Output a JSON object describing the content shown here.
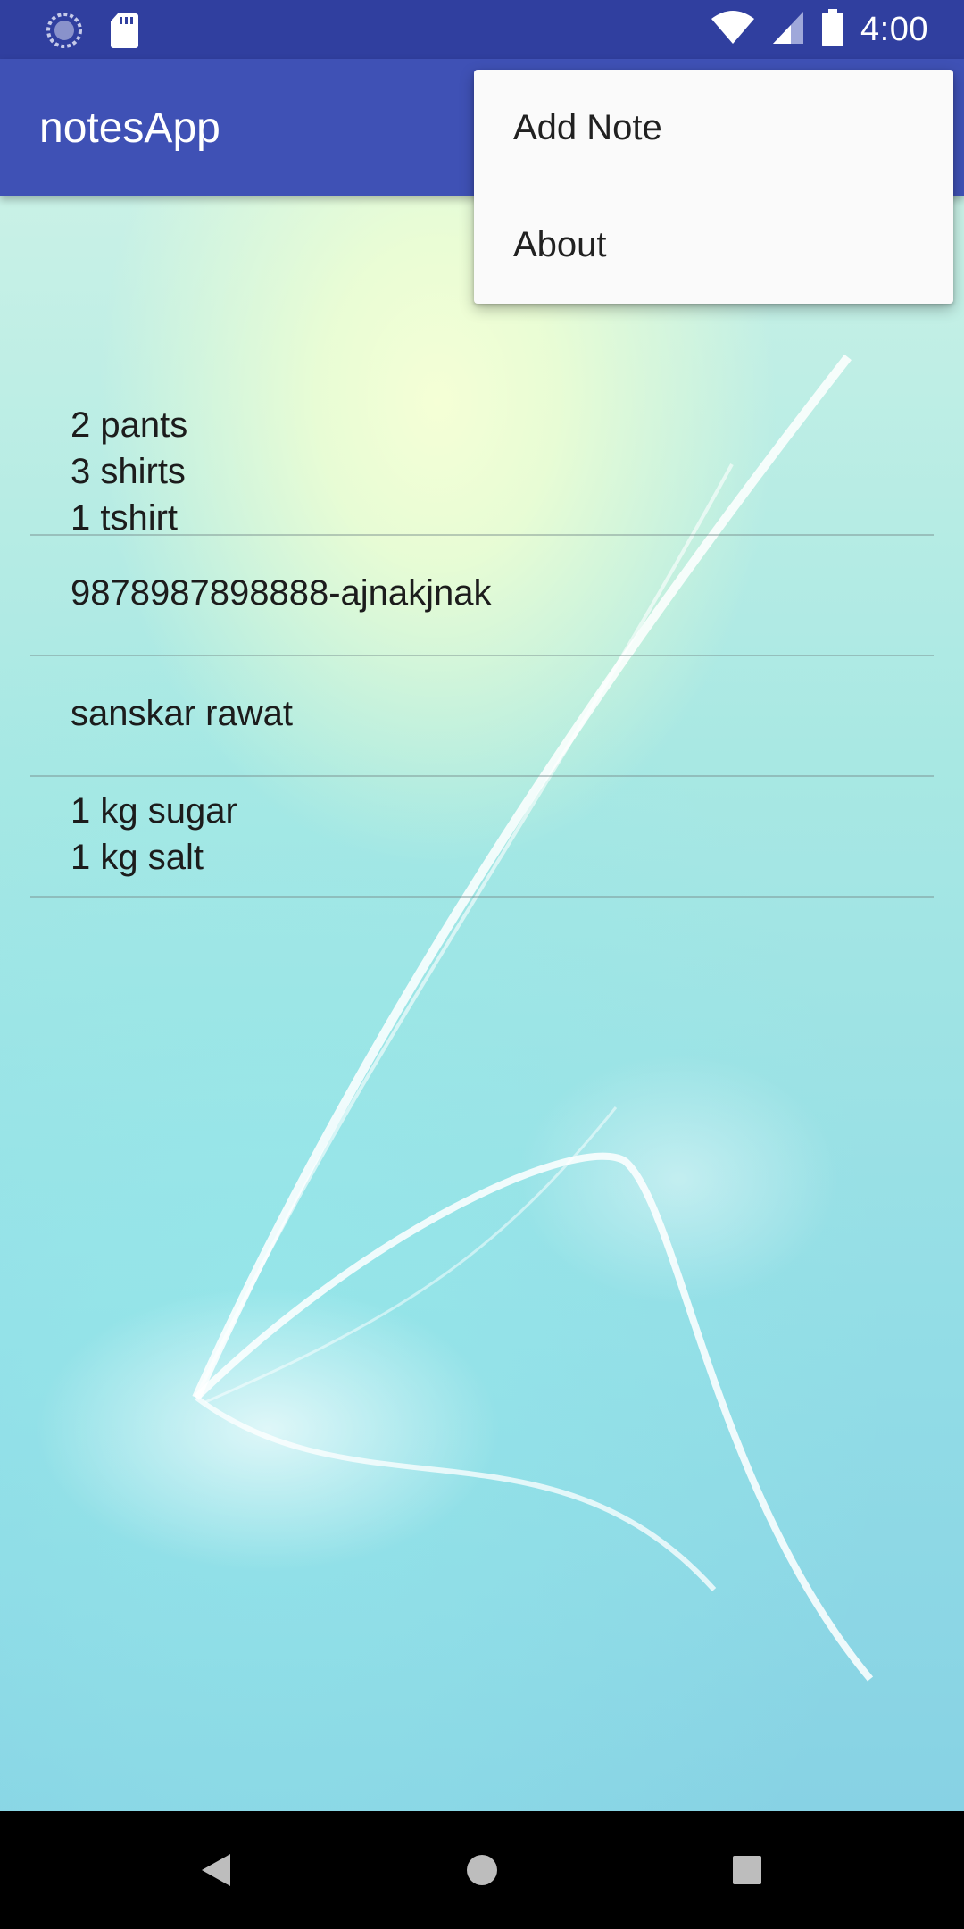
{
  "status_bar": {
    "time": "4:00",
    "left_icons": [
      "sync-icon",
      "sd-card-icon"
    ],
    "right_icons": [
      "wifi-icon",
      "cell-signal-icon",
      "battery-icon"
    ]
  },
  "app_bar": {
    "title": "notesApp",
    "color": "#3f51b5",
    "status_color": "#303f9f"
  },
  "overflow_menu": {
    "items": [
      {
        "label": "Add Note"
      },
      {
        "label": "About"
      }
    ]
  },
  "notes": [
    {
      "lines": [
        "2 pants",
        "3 shirts",
        "1 tshirt"
      ]
    },
    {
      "lines": [
        "9878987898888-ajnakjnak"
      ]
    },
    {
      "lines": [
        "sanskar rawat"
      ]
    },
    {
      "lines": [
        "1 kg sugar",
        "1 kg salt"
      ]
    }
  ],
  "nav_bar": {
    "buttons": [
      "back-icon",
      "home-icon",
      "recents-icon"
    ]
  }
}
